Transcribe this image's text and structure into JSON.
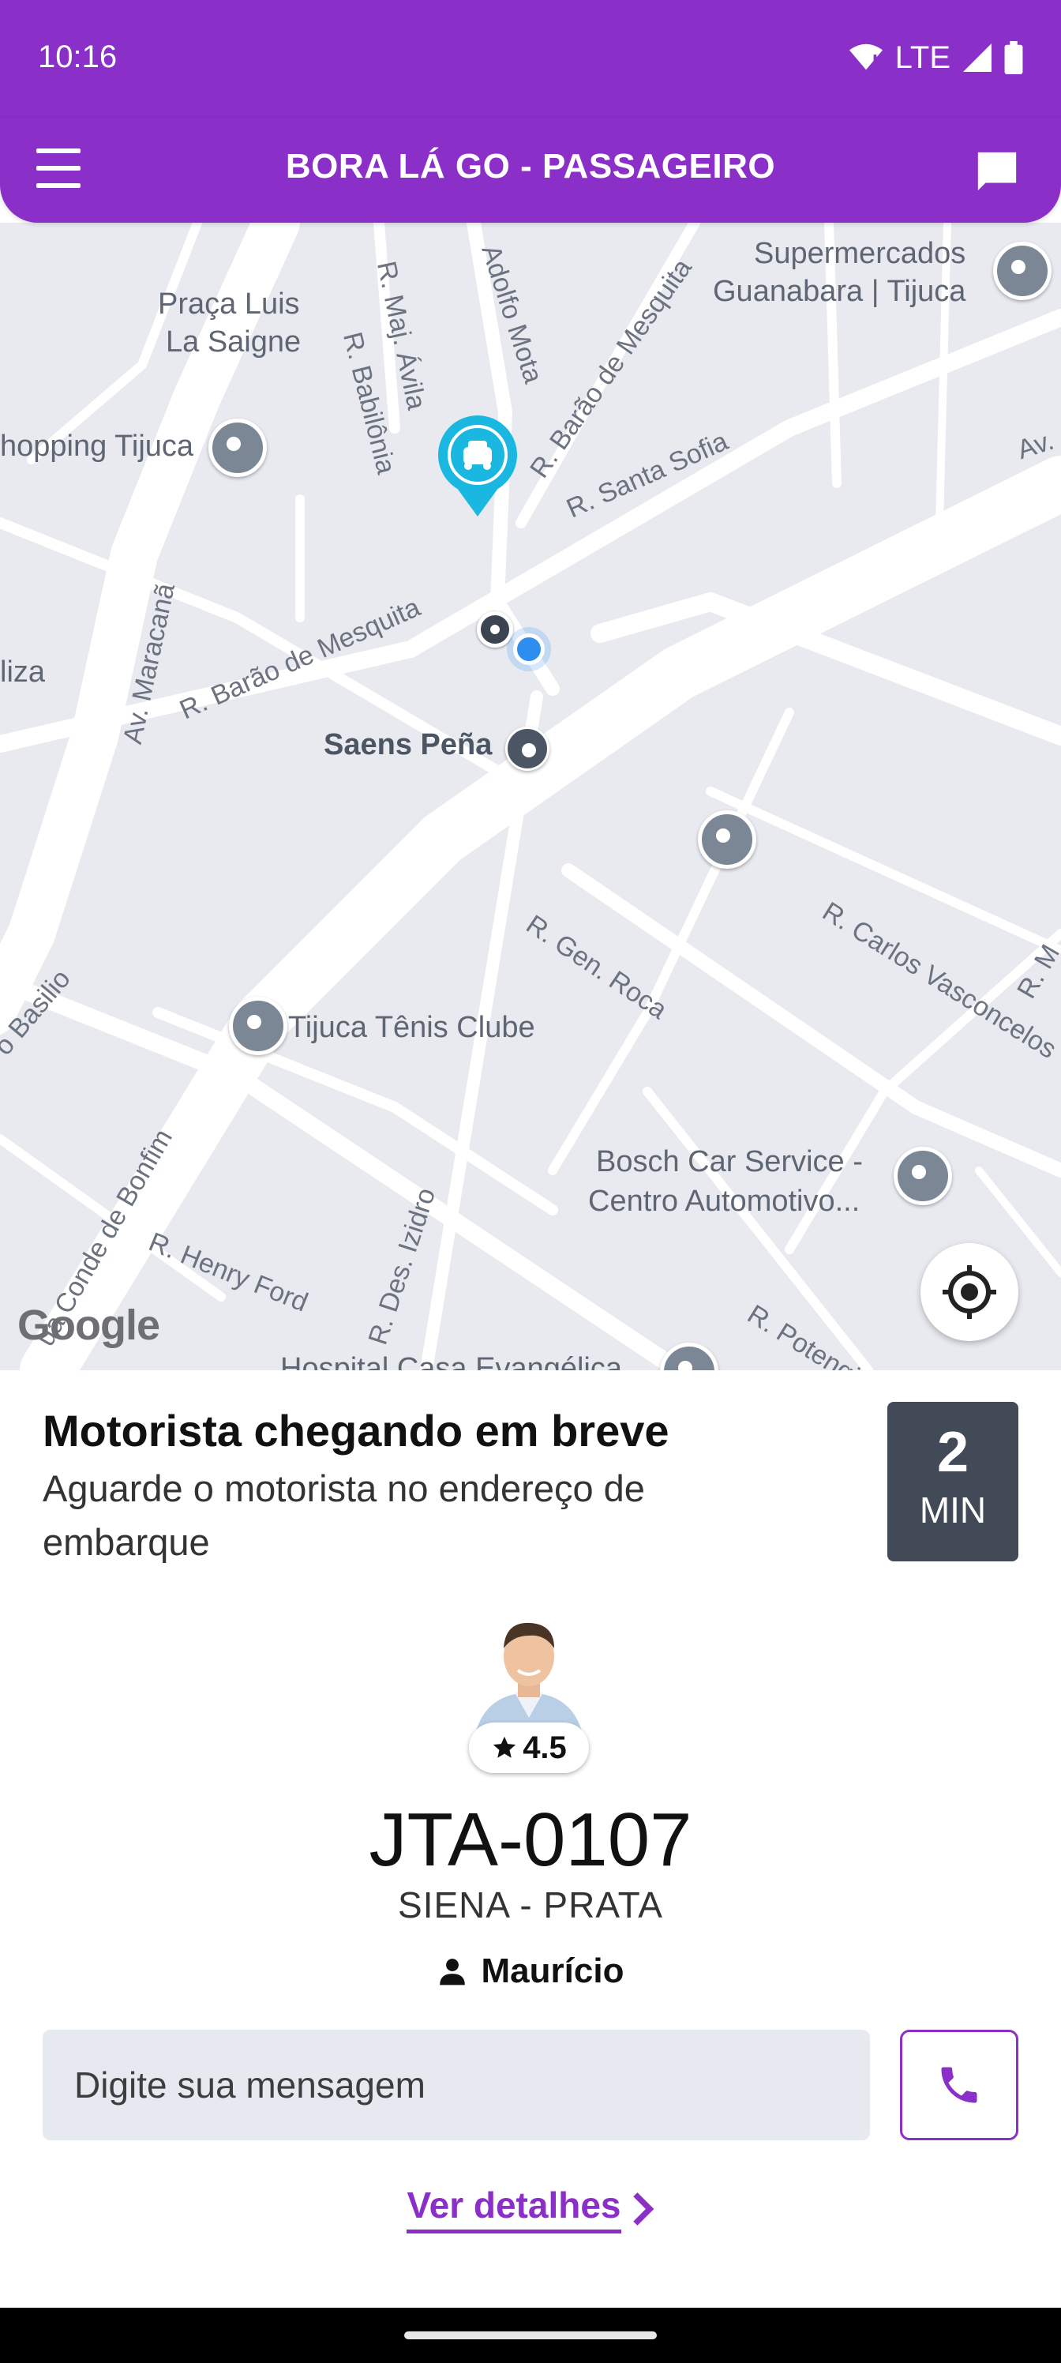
{
  "status_bar": {
    "time": "10:16",
    "network": "LTE"
  },
  "header": {
    "title": "BORA LÁ GO - PASSAGEIRO",
    "menu_icon": "hamburger-menu-icon",
    "chat_icon": "chat-bubble-icon",
    "color": "#8a2fc8"
  },
  "map": {
    "places": [
      "Praça Luis",
      "La Saigne",
      "Supermercados",
      "Guanabara | Tijuca",
      "hopping Tijuca",
      "liza",
      "Saens Peña",
      "Tijuca Tênis Clube",
      "Bosch Car Service -",
      "Centro Automotivo...",
      "Hospital Casa Evangélica"
    ],
    "streets": [
      "R. Maj. Ávila",
      "R. Babilônia",
      "Adolfo Mota",
      "R. Barão de Mesquita",
      "R. Santa Sofia",
      "Av.",
      "Av. Maracanã",
      "R. Barão de Mesquita",
      "R. Gen. Roca",
      "R. Carlos Vasconcelos",
      "R. M",
      "o Basilio",
      "ua Conde de Bonfim",
      "R. Henry Ford",
      "R. Des. Izidro",
      "R. Potengi"
    ],
    "attribution": "Google",
    "locate_icon": "my-location-icon"
  },
  "trip": {
    "headline": "Motorista chegando em breve",
    "message": "Aguarde o motorista no endereço de embarque",
    "eta_value": "2",
    "eta_unit": "MIN"
  },
  "driver": {
    "rating": "4.5",
    "plate": "JTA-0107",
    "car": "SIENA - PRATA",
    "name": "Maurício"
  },
  "chat": {
    "placeholder": "Digite sua mensagem"
  },
  "actions": {
    "details_label": "Ver detalhes"
  }
}
